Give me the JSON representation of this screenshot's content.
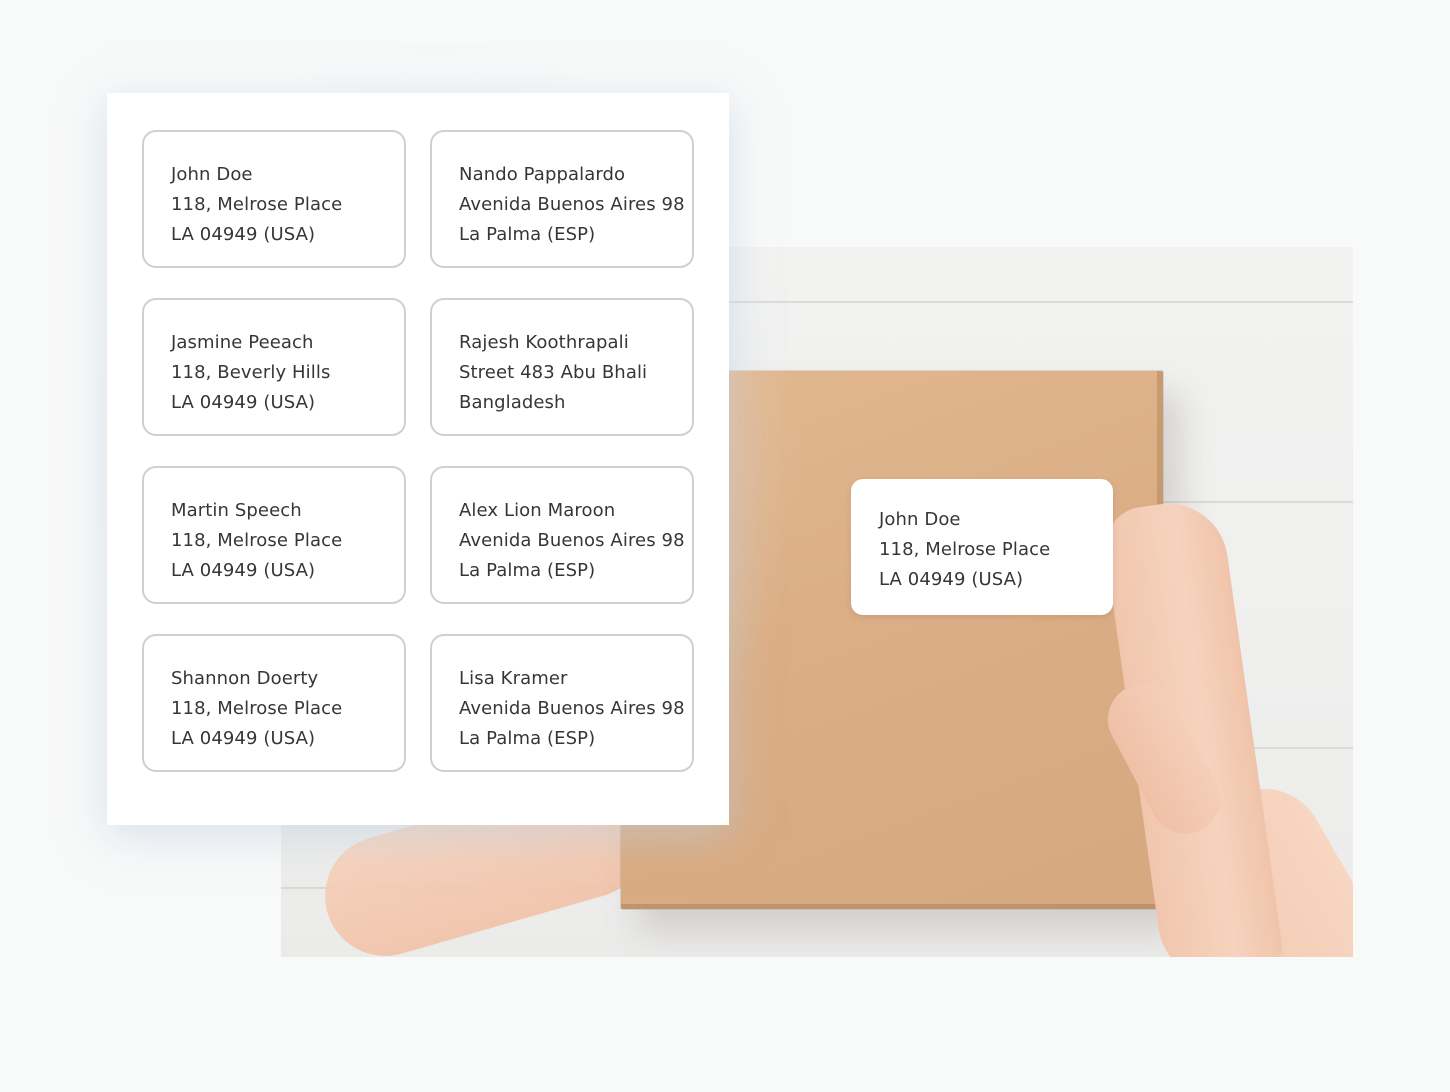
{
  "sheet_labels": [
    {
      "name": "John Doe",
      "street": "118, Melrose Place",
      "city": "LA 04949 (USA)"
    },
    {
      "name": "Nando Pappalardo",
      "street": "Avenida Buenos Aires 98",
      "city": "La Palma (ESP)"
    },
    {
      "name": "Jasmine Peeach",
      "street": "118, Beverly Hills",
      "city": "LA 04949 (USA)"
    },
    {
      "name": "Rajesh Koothrapali",
      "street": "Street 483 Abu Bhali",
      "city": "Bangladesh"
    },
    {
      "name": "Martin Speech",
      "street": "118, Melrose Place",
      "city": "LA 04949 (USA)"
    },
    {
      "name": "Alex Lion Maroon",
      "street": "Avenida Buenos Aires 98",
      "city": "La Palma (ESP)"
    },
    {
      "name": "Shannon Doerty",
      "street": "118, Melrose Place",
      "city": "LA 04949 (USA)"
    },
    {
      "name": "Lisa Kramer",
      "street": "Avenida Buenos Aires 98",
      "city": "La Palma (ESP)"
    }
  ],
  "box_label": {
    "name": "John Doe",
    "street": "118, Melrose Place",
    "city": "LA 04949 (USA)"
  },
  "colors": {
    "background": "#f8f9f9",
    "label_border": "#cdd0d3",
    "text": "#333738",
    "cardboard": "#dbae86"
  }
}
